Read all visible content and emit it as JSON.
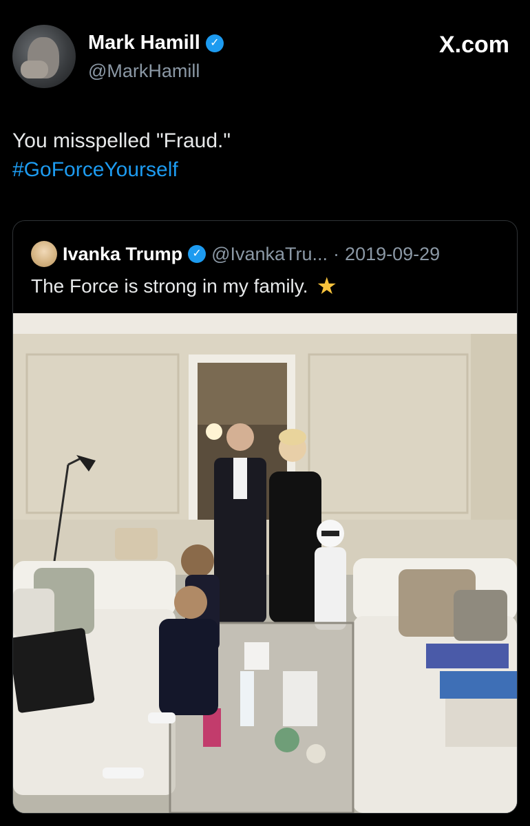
{
  "header": {
    "author_name": "Mark Hamill",
    "author_handle": "@MarkHamill",
    "site_label": "X.com"
  },
  "tweet": {
    "text": "You misspelled \"Fraud.\"",
    "hashtag": "#GoForceYourself"
  },
  "quote": {
    "author_name": "Ivanka Trump",
    "author_handle": "@IvankaTru...",
    "separator": "·",
    "date": "2019-09-29",
    "text": "The Force is strong in my family.",
    "emoji_icon": "star-icon"
  },
  "colors": {
    "background": "#000000",
    "link_blue": "#1d9bf0",
    "verified_blue": "#1d9bf0",
    "muted_text": "#8b98a5"
  }
}
